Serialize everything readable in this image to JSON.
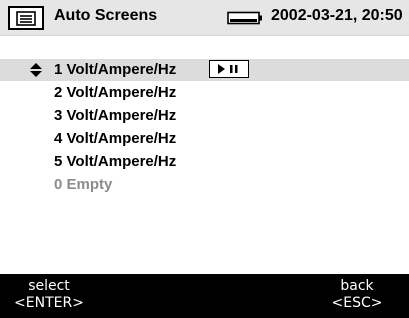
{
  "header": {
    "menu_icon": "menu-icon",
    "title": "Auto Screens",
    "battery_icon": "battery-icon",
    "datetime": "2002-03-21, 20:50"
  },
  "list": {
    "items": [
      {
        "label": "1 Volt/Ampere/Hz",
        "selected": true
      },
      {
        "label": "2 Volt/Ampere/Hz",
        "selected": false
      },
      {
        "label": "3 Volt/Ampere/Hz",
        "selected": false
      },
      {
        "label": "4 Volt/Ampere/Hz",
        "selected": false
      },
      {
        "label": "5 Volt/Ampere/Hz",
        "selected": false
      },
      {
        "label": "0 Empty",
        "selected": false
      }
    ],
    "selected_icon": "up-down-arrows-icon",
    "control_icon": "play-pause-icon"
  },
  "footer": {
    "left": {
      "line1": "select",
      "line2": "<ENTER>"
    },
    "right": {
      "line1": "back",
      "line2": "<ESC>"
    }
  },
  "colors": {
    "header_bg": "#e6e6e6",
    "selected_row_bg": "#dcdcdc",
    "footer_bg": "#000000",
    "empty_text": "#8c8c8c"
  }
}
